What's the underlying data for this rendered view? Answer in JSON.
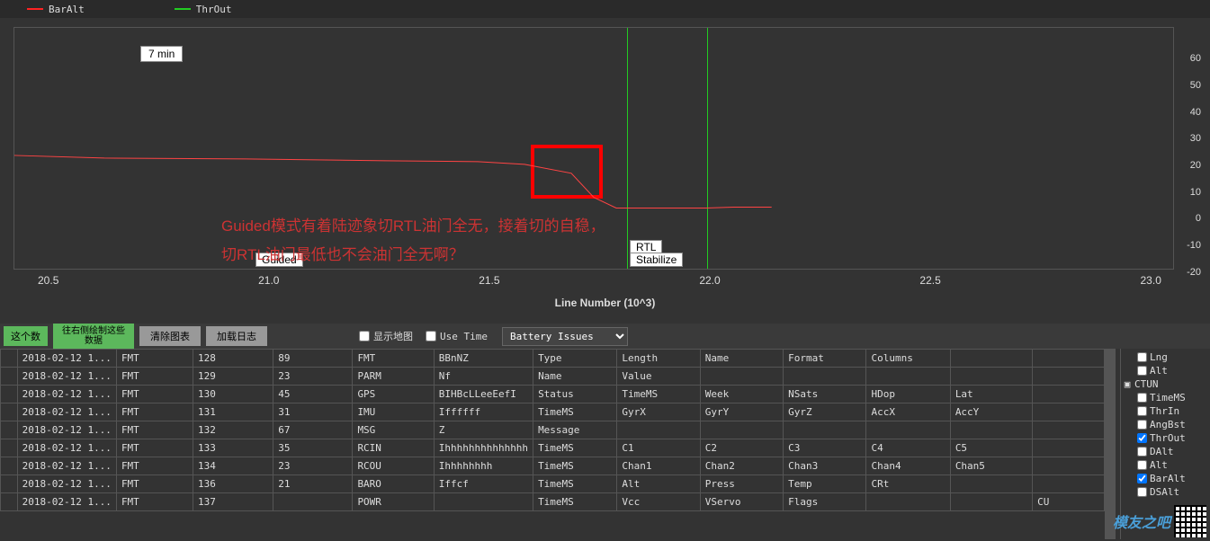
{
  "legend": [
    {
      "label": "BarAlt",
      "color": "#ff2222"
    },
    {
      "label": "ThrOut",
      "color": "#22cc22"
    }
  ],
  "chart_data": {
    "type": "line",
    "xlabel": "Line Number (10^3)",
    "ylabel": "",
    "xticks": [
      "20.5",
      "21.0",
      "21.5",
      "22.0",
      "22.5",
      "23.0"
    ],
    "yticks": [
      "60",
      "50",
      "40",
      "30",
      "20",
      "10",
      "0",
      "-10",
      "-20"
    ],
    "ylim": [
      -20,
      60
    ],
    "xlim": [
      20.5,
      23.0
    ],
    "time_marker": "7 min",
    "series": [
      {
        "name": "BarAlt",
        "color": "#ff2222",
        "x": [
          20.2,
          20.5,
          21.0,
          21.3,
          21.5,
          21.6,
          21.7,
          21.75,
          21.8,
          22.0,
          22.2,
          22.35
        ],
        "y": [
          18,
          17,
          17,
          16,
          16,
          15,
          12,
          4,
          0,
          0,
          0,
          0
        ]
      },
      {
        "name": "ThrOut",
        "color": "#22cc22",
        "x": [],
        "y": []
      }
    ],
    "mode_markers": [
      {
        "label": "Guided",
        "x": 20.9
      },
      {
        "label": "RTL",
        "x": 21.82
      },
      {
        "label": "Stabilize",
        "x": 21.88
      }
    ],
    "vertical_lines": [
      {
        "x": 21.82,
        "color": "#22cc22"
      },
      {
        "x": 21.99,
        "color": "#22cc22"
      }
    ],
    "annotations": [
      "Guided模式有着陆迹象切RTL油门全无，接着切的自稳，",
      "切RTL油门最低也不会油门全无啊？"
    ]
  },
  "toolbar": {
    "btn_left_partial": "这个数",
    "btn_rightplot": "往右侧绘制这些数据",
    "btn_clear": "清除图表",
    "btn_load": "加载日志",
    "chk_map": "显示地图",
    "chk_time": "Use Time",
    "dropdown_value": "Battery Issues"
  },
  "table": {
    "cols": [
      "c0",
      "c1",
      "c2",
      "c3",
      "c4",
      "c5",
      "c6",
      "c7",
      "c8",
      "c9",
      "c10",
      "c11",
      "c12"
    ],
    "rows": [
      [
        "2018-02-12 1...",
        "FMT",
        "128",
        "89",
        "FMT",
        "BBnNZ",
        "Type",
        "Length",
        "Name",
        "Format",
        "Columns",
        "",
        ""
      ],
      [
        "2018-02-12 1...",
        "FMT",
        "129",
        "23",
        "PARM",
        "Nf",
        "Name",
        "Value",
        "",
        "",
        "",
        "",
        ""
      ],
      [
        "2018-02-12 1...",
        "FMT",
        "130",
        "45",
        "GPS",
        "BIHBcLLeeEefI",
        "Status",
        "TimeMS",
        "Week",
        "NSats",
        "HDop",
        "Lat",
        ""
      ],
      [
        "2018-02-12 1...",
        "FMT",
        "131",
        "31",
        "IMU",
        "Iffffff",
        "TimeMS",
        "GyrX",
        "GyrY",
        "GyrZ",
        "AccX",
        "AccY",
        ""
      ],
      [
        "2018-02-12 1...",
        "FMT",
        "132",
        "67",
        "MSG",
        "Z",
        "Message",
        "",
        "",
        "",
        "",
        "",
        ""
      ],
      [
        "2018-02-12 1...",
        "FMT",
        "133",
        "35",
        "RCIN",
        "Ihhhhhhhhhhhhhh",
        "TimeMS",
        "C1",
        "C2",
        "C3",
        "C4",
        "C5",
        ""
      ],
      [
        "2018-02-12 1...",
        "FMT",
        "134",
        "23",
        "RCOU",
        "Ihhhhhhhh",
        "TimeMS",
        "Chan1",
        "Chan2",
        "Chan3",
        "Chan4",
        "Chan5",
        ""
      ],
      [
        "2018-02-12 1...",
        "FMT",
        "136",
        "21",
        "BARO",
        "Iffcf",
        "TimeMS",
        "Alt",
        "Press",
        "Temp",
        "CRt",
        "",
        ""
      ],
      [
        "2018-02-12 1...",
        "FMT",
        "137",
        "",
        "POWR",
        "",
        "TimeMS",
        "Vcc",
        "VServo",
        "Flags",
        "",
        "",
        "CU"
      ]
    ]
  },
  "tree": {
    "items": [
      {
        "label": "Lng",
        "checked": false,
        "indent": 2
      },
      {
        "label": "Alt",
        "checked": false,
        "indent": 2
      },
      {
        "label": "CTUN",
        "checked": false,
        "indent": 0,
        "expandable": true
      },
      {
        "label": "TimeMS",
        "checked": false,
        "indent": 2
      },
      {
        "label": "ThrIn",
        "checked": false,
        "indent": 2
      },
      {
        "label": "AngBst",
        "checked": false,
        "indent": 2
      },
      {
        "label": "ThrOut",
        "checked": true,
        "indent": 2
      },
      {
        "label": "DAlt",
        "checked": false,
        "indent": 2
      },
      {
        "label": "Alt",
        "checked": false,
        "indent": 2
      },
      {
        "label": "BarAlt",
        "checked": true,
        "indent": 2
      },
      {
        "label": "DSAlt",
        "checked": false,
        "indent": 2
      }
    ]
  },
  "watermark": {
    "text": "模友之吧"
  }
}
